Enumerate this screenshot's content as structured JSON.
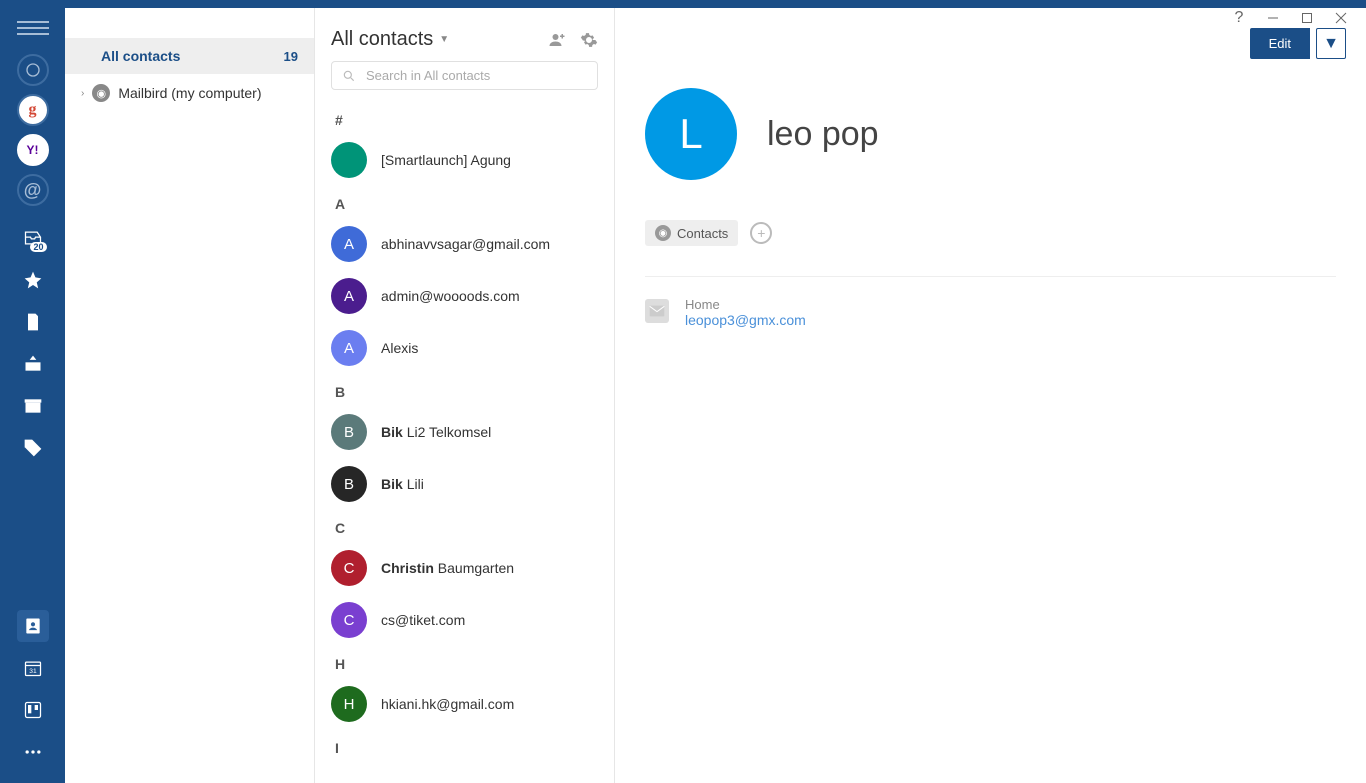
{
  "window": {
    "help": "?",
    "minimize": "–",
    "maximize": "□",
    "close": "✕"
  },
  "rail": {
    "accounts": [
      {
        "type": "outline",
        "label": ""
      },
      {
        "type": "google",
        "label": "g"
      },
      {
        "type": "yahoo",
        "label": "Y!"
      },
      {
        "type": "at",
        "label": "@"
      }
    ],
    "badge_count": "20"
  },
  "groups": {
    "all": {
      "label": "All contacts",
      "count": "19"
    },
    "source": {
      "label": "Mailbird (my computer)"
    }
  },
  "list": {
    "title": "All contacts",
    "search_placeholder": "Search in All contacts",
    "sections": [
      {
        "letter": "#",
        "items": [
          {
            "initial": "",
            "color": "#009478",
            "bold": "",
            "rest": "[Smartlaunch] Agung"
          }
        ]
      },
      {
        "letter": "A",
        "items": [
          {
            "initial": "A",
            "color": "#3f6bd8",
            "bold": "",
            "rest": "abhinavvsagar@gmail.com"
          },
          {
            "initial": "A",
            "color": "#4b1d8e",
            "bold": "",
            "rest": "admin@woooods.com"
          },
          {
            "initial": "A",
            "color": "#6b7ef0",
            "bold": "",
            "rest": "Alexis"
          }
        ]
      },
      {
        "letter": "B",
        "items": [
          {
            "initial": "B",
            "color": "#5b7a7a",
            "bold": "Bik ",
            "rest": "Li2 Telkomsel"
          },
          {
            "initial": "B",
            "color": "#262626",
            "bold": "Bik ",
            "rest": "Lili"
          }
        ]
      },
      {
        "letter": "C",
        "items": [
          {
            "initial": "C",
            "color": "#b01f2e",
            "bold": "Christin ",
            "rest": "Baumgarten"
          },
          {
            "initial": "C",
            "color": "#7a3fd0",
            "bold": "",
            "rest": "cs@tiket.com"
          }
        ]
      },
      {
        "letter": "H",
        "items": [
          {
            "initial": "H",
            "color": "#1e6b1e",
            "bold": "",
            "rest": "hkiani.hk@gmail.com"
          }
        ]
      },
      {
        "letter": "I",
        "items": []
      }
    ]
  },
  "detail": {
    "edit_label": "Edit",
    "avatar_initial": "L",
    "name": "leo pop",
    "tag_label": "Contacts",
    "email_label": "Home",
    "email_value": "leopop3@gmx.com"
  }
}
